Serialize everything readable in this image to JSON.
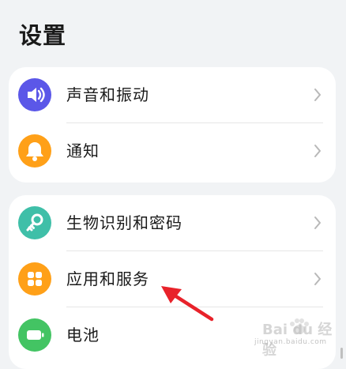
{
  "header": {
    "title": "设置"
  },
  "groups": [
    {
      "items": [
        {
          "label": "声音和振动",
          "icon": "speaker-icon",
          "color": "#5b57e8"
        },
        {
          "label": "通知",
          "icon": "bell-icon",
          "color": "#ffa018"
        }
      ]
    },
    {
      "items": [
        {
          "label": "生物识别和密码",
          "icon": "key-icon",
          "color": "#3fbfa8"
        },
        {
          "label": "应用和服务",
          "icon": "apps-grid-icon",
          "color": "#ffa018"
        },
        {
          "label": "电池",
          "icon": "battery-icon",
          "color": "#43c463"
        }
      ]
    }
  ],
  "watermark": {
    "text": "Bai du 经验",
    "subtext": "jingyan.baidu.com"
  },
  "annotation": {
    "arrow_color": "#e8222a"
  }
}
